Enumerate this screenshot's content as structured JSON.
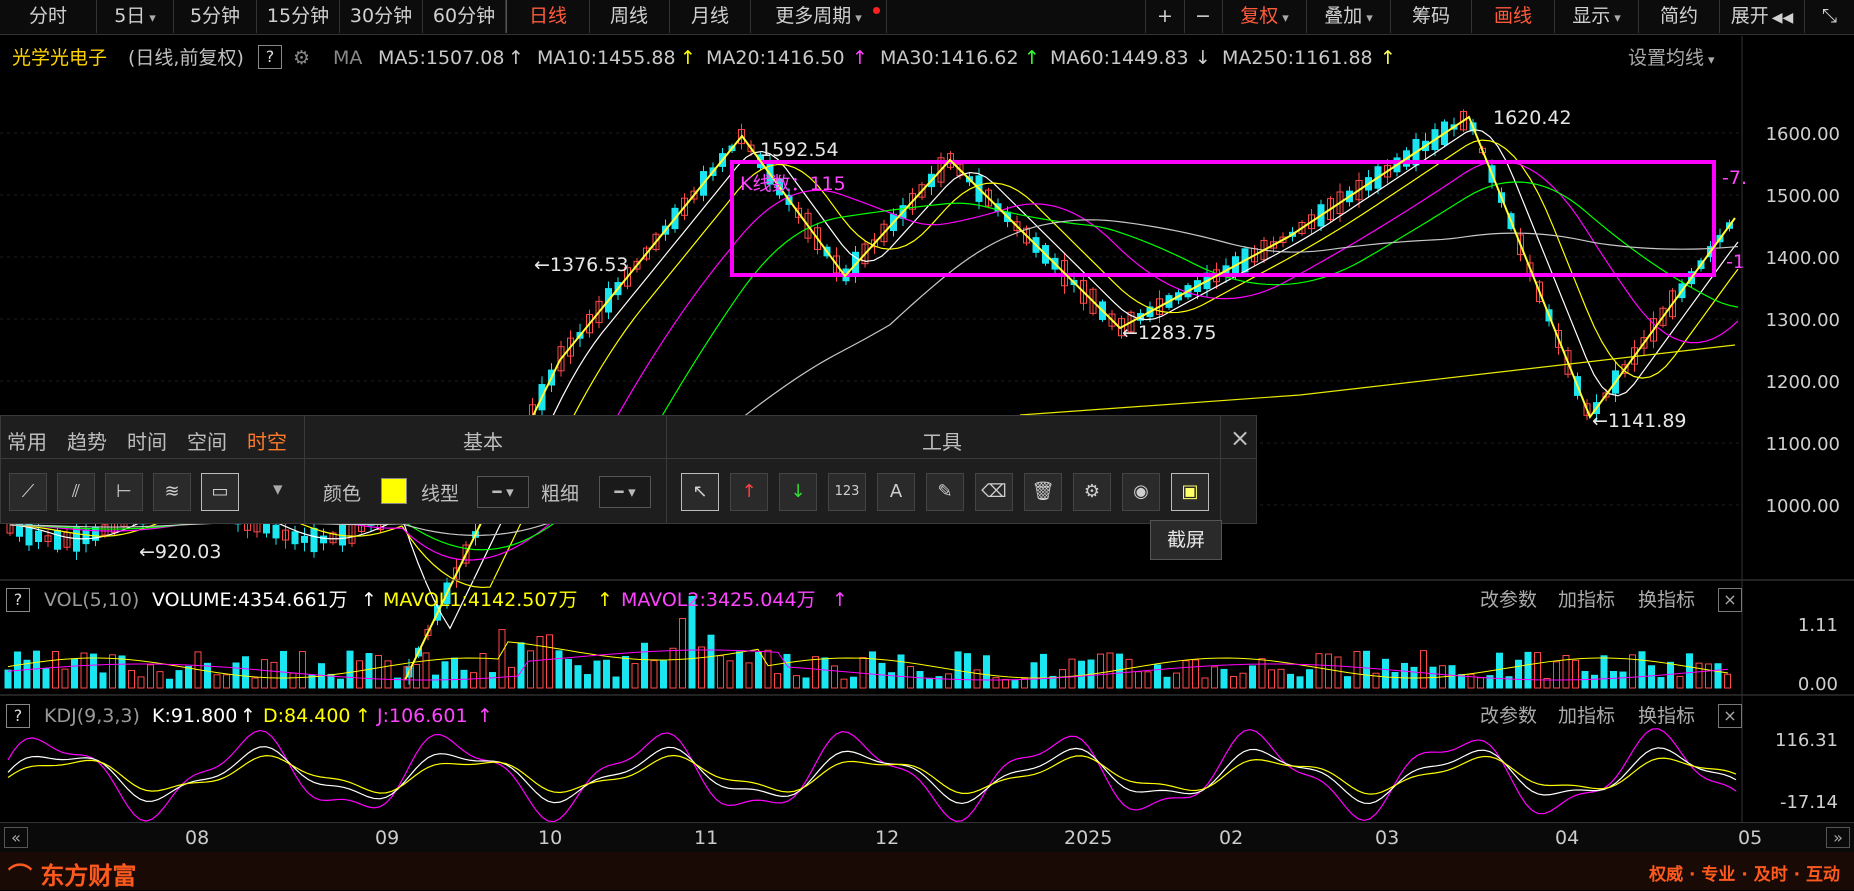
{
  "colors": {
    "accent": "#ff5a3c",
    "up": "#ff4848",
    "down": "#19e6f0",
    "ma5": "#ffffff",
    "ma10": "#ffff00",
    "ma20": "#ff00ff",
    "ma30": "#00ff00",
    "ma60": "#c8c8c8",
    "ma250": "#e8e800",
    "box": "#ff00ff",
    "zigzag": "#ffff33"
  },
  "toolbar": {
    "periods": [
      "分时",
      "5日",
      "5分钟",
      "15分钟",
      "30分钟",
      "60分钟",
      "日线",
      "周线",
      "月线",
      "更多周期"
    ],
    "right": [
      "复权",
      "叠加",
      "筹码",
      "画线",
      "显示",
      "简约",
      "展开"
    ],
    "plus": "+",
    "minus": "−"
  },
  "ma_header": {
    "stock": "光学光电子",
    "mode": "(日线,前复权)",
    "q": "?",
    "ma": "MA",
    "items": [
      {
        "text": "MA5:1507.08",
        "color": "#ffffff"
      },
      {
        "text": "MA10:1455.88",
        "color": "#ffff00"
      },
      {
        "text": "MA20:1416.50",
        "color": "#ff44ff"
      },
      {
        "text": "MA30:1416.62",
        "color": "#33ff33"
      },
      {
        "text": "MA60:1449.83",
        "color": "#cccccc"
      },
      {
        "text": "MA250:1161.88",
        "color": "#ffff66"
      }
    ],
    "settings": "设置均线"
  },
  "price_axis": [
    "1600.00",
    "1500.00",
    "1400.00",
    "1300.00",
    "1200.00",
    "1100.00",
    "1000.00"
  ],
  "annotations": {
    "hi1": "1592.54",
    "lo1": "←1376.53",
    "hi2": "1620.42",
    "lo2": "←1283.75",
    "lo3": "←1141.89",
    "lo4": "←920.03",
    "kcount": "K线数：115",
    "edge1": "-7.",
    "edge2": "-1"
  },
  "toolbox": {
    "tabs": [
      "常用",
      "趋势",
      "时间",
      "空间",
      "时空"
    ],
    "basic_title": "基本",
    "tools_title": "工具",
    "color_label": "颜色",
    "line_type_label": "线型",
    "width_label": "粗细",
    "tool_glyphs": [
      "↖",
      "↑",
      "↓",
      "123",
      "A",
      "✎",
      "⌫",
      "🗑",
      "⚙",
      "◉",
      "▣"
    ],
    "close": "×"
  },
  "tooltip": "截屏",
  "vol": {
    "q": "?",
    "name": "VOL(5,10)",
    "items": [
      {
        "text": "VOLUME:4354.661万",
        "color": "#ffffff"
      },
      {
        "text": "MAVOL1:4142.507万",
        "color": "#ffff00"
      },
      {
        "text": "MAVOL2:3425.044万",
        "color": "#ff44ff"
      }
    ],
    "axis": [
      "1.11",
      "0.00"
    ]
  },
  "kdj": {
    "q": "?",
    "name": "KDJ(9,3,3)",
    "items": [
      {
        "text": "K:91.800",
        "color": "#ffffff"
      },
      {
        "text": "D:84.400",
        "color": "#ffff00"
      },
      {
        "text": "J:106.601",
        "color": "#ff44ff"
      }
    ],
    "axis": [
      "116.31",
      "-17.14"
    ]
  },
  "ind_buttons": [
    "改参数",
    "加指标",
    "换指标"
  ],
  "close_x": "×",
  "time_axis": [
    "08",
    "09",
    "10",
    "11",
    "12",
    "2025",
    "02",
    "03",
    "04",
    "05"
  ],
  "footer": {
    "logo": "东方财富",
    "slogan": "权威 · 专业 · 及时 · 互动"
  }
}
